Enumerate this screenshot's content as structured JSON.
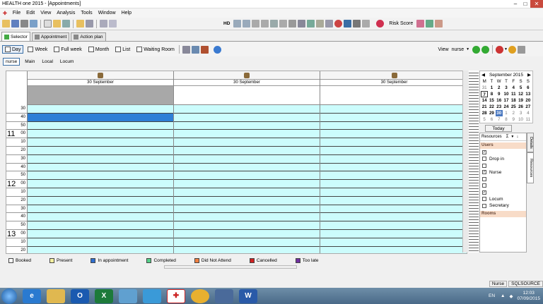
{
  "window": {
    "title": "HEALTH one 2015 - [Appointments]"
  },
  "menu": [
    "File",
    "Edit",
    "View",
    "Analysis",
    "Tools",
    "Window",
    "Help"
  ],
  "toolbar": {
    "hd_label": "HD",
    "risk_score_label": "Risk Score"
  },
  "tabs": [
    {
      "label": "Selector",
      "active": true
    },
    {
      "label": "Appointment",
      "active": false
    },
    {
      "label": "Action plan",
      "active": false
    }
  ],
  "views": [
    {
      "label": "Day",
      "active": true
    },
    {
      "label": "Week",
      "active": false
    },
    {
      "label": "Full week",
      "active": false
    },
    {
      "label": "Month",
      "active": false
    },
    {
      "label": "List",
      "active": false
    },
    {
      "label": "Waiting Room",
      "active": false
    }
  ],
  "view_selector": {
    "label": "View",
    "value": "nurse"
  },
  "resource_tabs": [
    {
      "label": "nurse",
      "active": true
    },
    {
      "label": "Main",
      "active": false
    },
    {
      "label": "Local",
      "active": false
    },
    {
      "label": "Locum",
      "active": false
    }
  ],
  "columns": [
    {
      "date": "30 September"
    },
    {
      "date": "30 September"
    },
    {
      "date": "30 September"
    }
  ],
  "time_rows": [
    {
      "hour": "",
      "minute": "30"
    },
    {
      "hour": "",
      "minute": "40"
    },
    {
      "hour": "",
      "minute": "50"
    },
    {
      "hour": "11",
      "minute": "00"
    },
    {
      "hour": "",
      "minute": "10"
    },
    {
      "hour": "",
      "minute": "20"
    },
    {
      "hour": "",
      "minute": "30"
    },
    {
      "hour": "",
      "minute": "40"
    },
    {
      "hour": "",
      "minute": "50"
    },
    {
      "hour": "12",
      "minute": "00"
    },
    {
      "hour": "",
      "minute": "10"
    },
    {
      "hour": "",
      "minute": "20"
    },
    {
      "hour": "",
      "minute": "30"
    },
    {
      "hour": "",
      "minute": "40"
    },
    {
      "hour": "",
      "minute": "50"
    },
    {
      "hour": "13",
      "minute": "00"
    },
    {
      "hour": "",
      "minute": "10"
    },
    {
      "hour": "",
      "minute": "20"
    }
  ],
  "calendar": {
    "month_label": "September 2015",
    "weekdays": [
      "M",
      "T",
      "W",
      "T",
      "F",
      "S",
      "S"
    ],
    "weeks": [
      [
        "31",
        "1",
        "2",
        "3",
        "4",
        "5",
        "6"
      ],
      [
        "7",
        "8",
        "9",
        "10",
        "11",
        "12",
        "13"
      ],
      [
        "14",
        "15",
        "16",
        "17",
        "18",
        "19",
        "20"
      ],
      [
        "21",
        "22",
        "23",
        "24",
        "25",
        "26",
        "27"
      ],
      [
        "28",
        "29",
        "30",
        "1",
        "2",
        "3",
        "4"
      ],
      [
        "5",
        "6",
        "7",
        "8",
        "9",
        "10",
        "11"
      ]
    ],
    "today_button": "Today"
  },
  "resources_panel": {
    "header": "Resources",
    "sigma": "Σ",
    "side_tabs": [
      "Details",
      "Resources"
    ],
    "groups": [
      {
        "name": "Users",
        "items": [
          {
            "label": "",
            "checked": true
          },
          {
            "label": "Drop in",
            "checked": false
          },
          {
            "label": "",
            "checked": false
          },
          {
            "label": "Nurse",
            "checked": true
          },
          {
            "label": "",
            "checked": false
          },
          {
            "label": "",
            "checked": false
          },
          {
            "label": "",
            "checked": true
          },
          {
            "label": "Locum",
            "checked": false
          },
          {
            "label": "Secretary",
            "checked": false
          }
        ]
      },
      {
        "name": "Rooms",
        "items": []
      }
    ]
  },
  "legend": [
    {
      "label": "Booked",
      "color": "#ffffff"
    },
    {
      "label": "Present",
      "color": "#f5f0a0"
    },
    {
      "label": "In appointment",
      "color": "#2f6fd0"
    },
    {
      "label": "Completed",
      "color": "#55d08a"
    },
    {
      "label": "Did Not Attend",
      "color": "#f08040"
    },
    {
      "label": "Cancelled",
      "color": "#d02020"
    },
    {
      "label": "Too late",
      "color": "#7030a0"
    }
  ],
  "status": {
    "user": "Nurse",
    "source": "SQLSOURCE"
  },
  "taskbar": {
    "lang": "EN",
    "time": "12:03",
    "date": "07/09/2015"
  },
  "colors": {
    "slot": "#ccfcfc",
    "selected_slot": "#2f7fd6",
    "header_gray": "#a8a8a8"
  }
}
